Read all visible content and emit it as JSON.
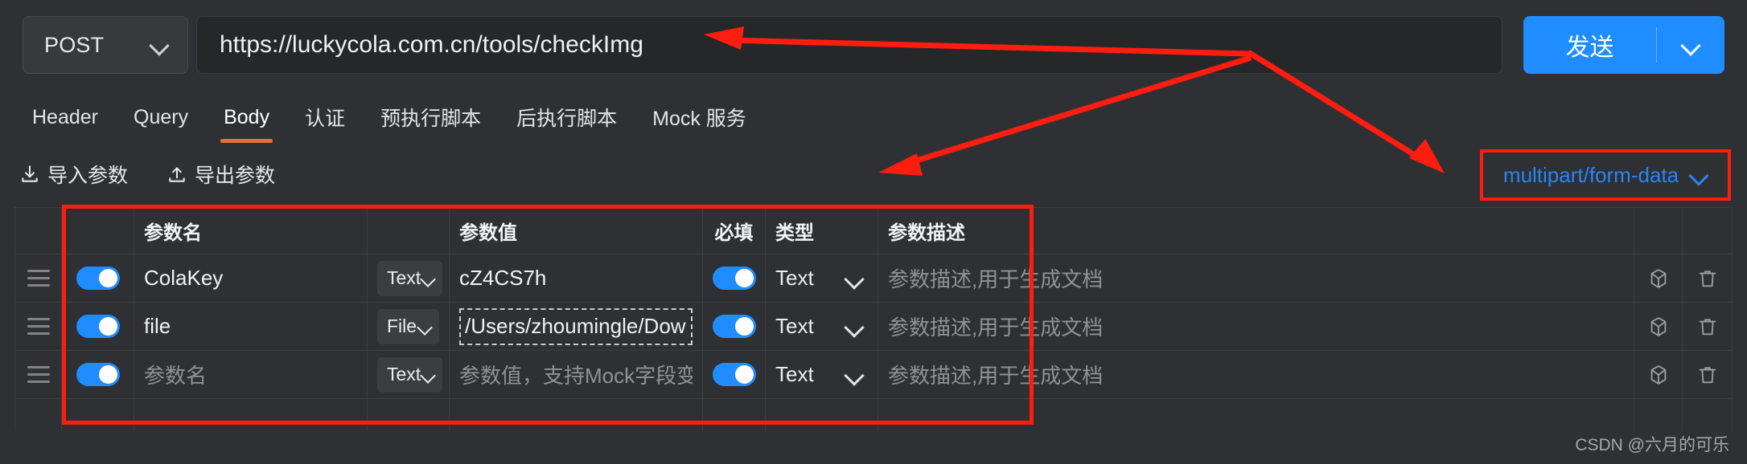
{
  "request": {
    "method": "POST",
    "url": "https://luckycola.com.cn/tools/checkImg",
    "send_label": "发送"
  },
  "tabs": [
    {
      "label": "Header",
      "active": false
    },
    {
      "label": "Query",
      "active": false
    },
    {
      "label": "Body",
      "active": true
    },
    {
      "label": "认证",
      "active": false
    },
    {
      "label": "预执行脚本",
      "active": false
    },
    {
      "label": "后执行脚本",
      "active": false
    },
    {
      "label": "Mock 服务",
      "active": false
    }
  ],
  "toolbar": {
    "import_label": "导入参数",
    "export_label": "导出参数",
    "content_type": "multipart/form-data"
  },
  "table": {
    "headers": {
      "name": "参数名",
      "value": "参数值",
      "required": "必填",
      "type": "类型",
      "description": "参数描述"
    },
    "rows": [
      {
        "name": "ColaKey",
        "name_placeholder": "",
        "name_type": "Text",
        "value": "cZ4CS7h",
        "value_placeholder": "",
        "value_is_file": false,
        "type": "Text",
        "description_placeholder": "参数描述,用于生成文档"
      },
      {
        "name": "file",
        "name_placeholder": "",
        "name_type": "File",
        "value": "/Users/zhoumingle/Downloads/gongan.",
        "value_placeholder": "",
        "value_is_file": true,
        "type": "Text",
        "description_placeholder": "参数描述,用于生成文档"
      },
      {
        "name": "",
        "name_placeholder": "参数名",
        "name_type": "Text",
        "value": "",
        "value_placeholder": "参数值，支持Mock字段变量",
        "value_is_file": false,
        "type": "Text",
        "description_placeholder": "参数描述,用于生成文档"
      }
    ]
  },
  "icons": {
    "method_chevron": "chevron-down-icon",
    "send_chevron": "chevron-down-icon",
    "import": "download-icon",
    "export": "upload-icon",
    "content_type_chevron": "chevron-down-icon",
    "drag": "drag-handle-icon",
    "cube": "cube-icon",
    "delete": "trash-icon"
  },
  "colors": {
    "accent_blue": "#1f8cff",
    "active_tab_underline": "#ea6b3c",
    "annotation_red": "#ff1d10",
    "link_blue": "#2b84f5",
    "background": "#2e3033"
  },
  "watermark": "CSDN @六月的可乐"
}
